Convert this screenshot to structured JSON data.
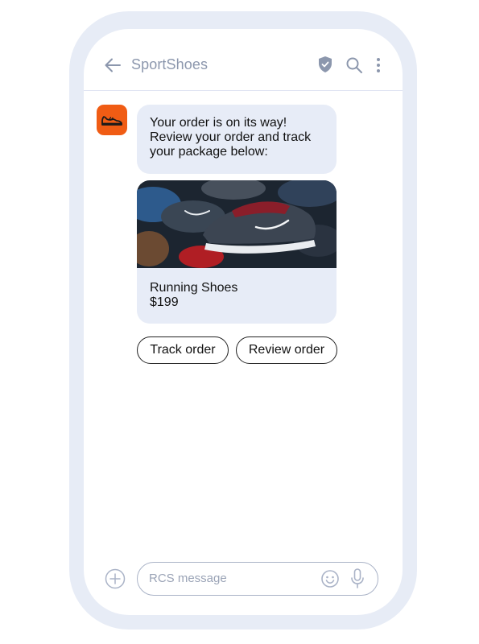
{
  "header": {
    "title": "SportShoes",
    "icons": [
      "back-arrow-icon",
      "verified-shield-icon",
      "search-icon",
      "more-vert-icon"
    ]
  },
  "conversation": {
    "sender_avatar_icon": "sneaker-icon",
    "message_lines": [
      "Your order is on its way!",
      "Review your order and track",
      "your package below:"
    ],
    "card": {
      "image_description": "shoes-photo",
      "product_name": "Running Shoes",
      "price": "$199"
    },
    "suggestions": [
      "Track order",
      "Review order"
    ]
  },
  "composer": {
    "placeholder": "RCS message",
    "icons": [
      "add-circle-icon",
      "emoji-icon",
      "mic-icon"
    ]
  },
  "colors": {
    "brand_orange": "#f05c14",
    "bubble_bg": "#e7ecf7",
    "frame_bg": "#e7ecf6",
    "header_text": "#8c97ad"
  }
}
